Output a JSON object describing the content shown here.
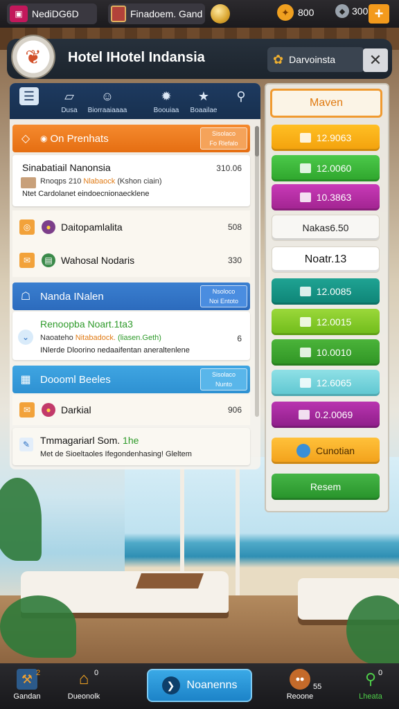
{
  "topbar": {
    "app_name": "NediDG6D",
    "title": "Finadoem. Gand",
    "resource1": "800",
    "resource2": "300",
    "plus": "+"
  },
  "header": {
    "title": "Hotel IHotel Indansia",
    "location": "Darvoinsta",
    "close": "✕"
  },
  "tabs": [
    {
      "label": "",
      "icon": "list-icon"
    },
    {
      "label": "Dusa",
      "icon": "document-icon"
    },
    {
      "label": "Biorraaiaaaa",
      "icon": "people-icon"
    },
    {
      "label": "Boouiaa",
      "icon": "gear-icon"
    },
    {
      "label": "Boaailae",
      "icon": "star-icon"
    },
    {
      "label": "",
      "icon": "pin-icon"
    }
  ],
  "sections": {
    "s1": {
      "title": "On Prenhats",
      "badge_top": "Sisolaco",
      "badge_bottom": "Fo Rlefalo"
    },
    "card1": {
      "title": "Sinabatiail Nanonsia",
      "value": "310.06",
      "sub_a": "Rnoqps 210",
      "sub_b": "Nlabaock",
      "sub_c": "(Kshon ciain)",
      "desc": "Ntet Cardolanet eindoecnionaecklene"
    },
    "row1": {
      "label": "Daitopamlalita",
      "value": "508"
    },
    "row2": {
      "label": "Wahosal Nodaris",
      "value": "330"
    },
    "s2": {
      "title": "Nanda INalen",
      "badge_top": "Nsoloco",
      "badge_bottom": "Noi Entoto"
    },
    "card2": {
      "title": "Renoopba Noart.1ta3",
      "value": "6",
      "sub_a": "Naoateho",
      "sub_b": "Nitabadock.",
      "sub_c": "(liasen.Geth)",
      "desc": "INlerde Dloorino nedaaifentan aneraltenlene"
    },
    "s3": {
      "title": "Doooml Beeles",
      "badge_top": "Sisolaco",
      "badge_bottom": "Nunto"
    },
    "row3": {
      "label": "Darkial",
      "value": "906"
    },
    "card3": {
      "title": "Tmmagariarl Som.",
      "title_hl": "1he",
      "desc": "Met de Sioeltaoles Ifegondenhasing! Gleltem"
    }
  },
  "right_menu": {
    "menu_label": "Maven",
    "buttons": [
      {
        "label": "12.9063",
        "color": "yellow"
      },
      {
        "label": "12.0060",
        "color": "green"
      },
      {
        "label": "10.3863",
        "color": "magenta"
      },
      {
        "label": "Nakas6.50",
        "color": "white"
      },
      {
        "label": "Noatr.13",
        "color": "white"
      },
      {
        "label": "12.0085",
        "color": "teal"
      },
      {
        "label": "12.0015",
        "color": "lime"
      },
      {
        "label": "10.0010",
        "color": "dark-green"
      },
      {
        "label": "12.6065",
        "color": "light-cyan"
      },
      {
        "label": "0.2.0069",
        "color": "purple"
      },
      {
        "label": "Cunotian",
        "color": "orange"
      },
      {
        "label": "Resem",
        "color": "green"
      }
    ]
  },
  "bottom_nav": {
    "item1": {
      "label": "Gandan",
      "badge": "2"
    },
    "item2": {
      "label": "Dueonolk",
      "badge": "0"
    },
    "cta": {
      "label": "Noanenns"
    },
    "item3": {
      "label": "Reoone",
      "badge": "55"
    },
    "item4": {
      "label": "Lheata",
      "badge": "0"
    }
  }
}
